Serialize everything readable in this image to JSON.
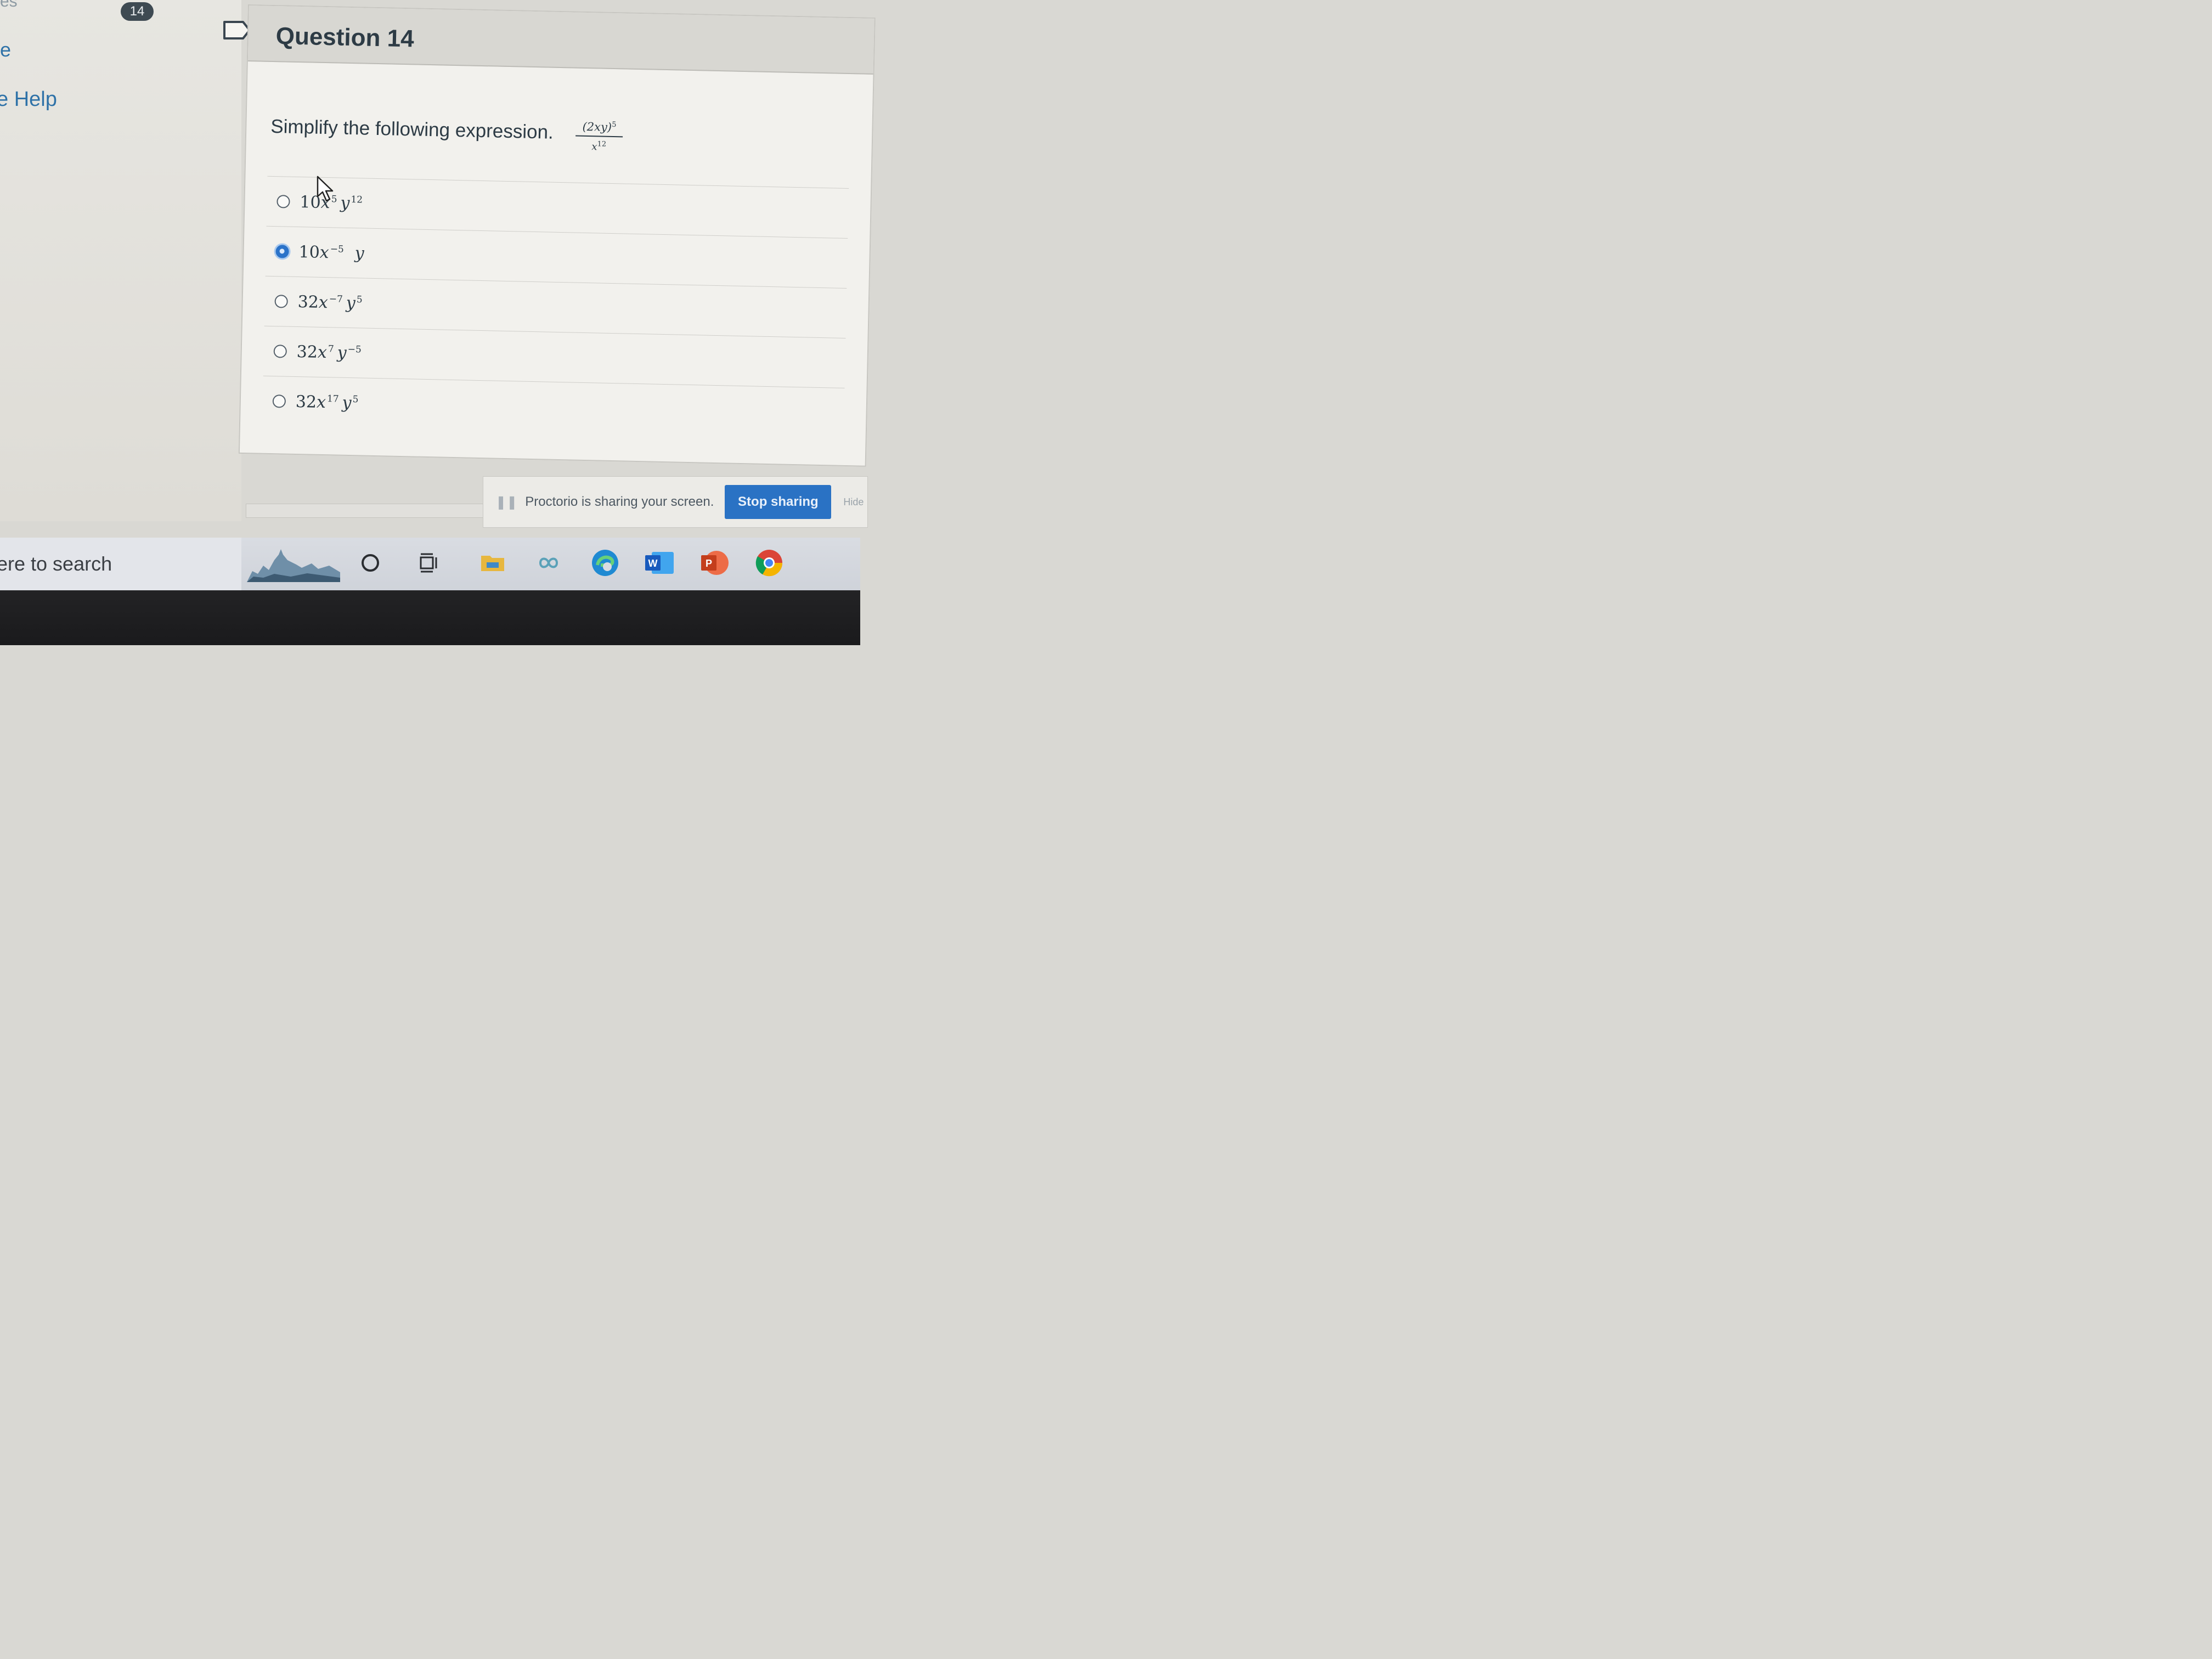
{
  "sidebar": {
    "top_cut_text": "es",
    "badge_count": "14",
    "item_partial": "e",
    "help_label": "e Help"
  },
  "question": {
    "title": "Question 14",
    "prompt": "Simplify the following expression.",
    "expression": {
      "numerator_base": "(2xy)",
      "numerator_exp": "5",
      "denominator_base": "x",
      "denominator_exp": "12"
    },
    "answers": [
      {
        "coef": "10",
        "x_exp": "5",
        "y_exp": "12",
        "selected": false
      },
      {
        "coef": "10",
        "x_exp": "−5",
        "y_exp": "",
        "selected": true
      },
      {
        "coef": "32",
        "x_exp": "−7",
        "y_exp": "5",
        "selected": false
      },
      {
        "coef": "32",
        "x_exp": "7",
        "y_exp": "−5",
        "selected": false
      },
      {
        "coef": "32",
        "x_exp": "17",
        "y_exp": "5",
        "selected": false
      }
    ]
  },
  "screen_share": {
    "message": "Proctorio is sharing your screen.",
    "stop_label": "Stop sharing",
    "hide_label": "Hide"
  },
  "taskbar": {
    "search_text": "ere to search",
    "icons": [
      "city-skyline-widget-icon",
      "cortana-icon",
      "task-view-icon",
      "file-explorer-icon",
      "infinity-app-icon",
      "edge-icon",
      "word-icon",
      "powerpoint-icon",
      "chrome-icon"
    ]
  },
  "colors": {
    "accent": "#2b73c9",
    "text": "#2d3b45",
    "link": "#2f72a8"
  }
}
